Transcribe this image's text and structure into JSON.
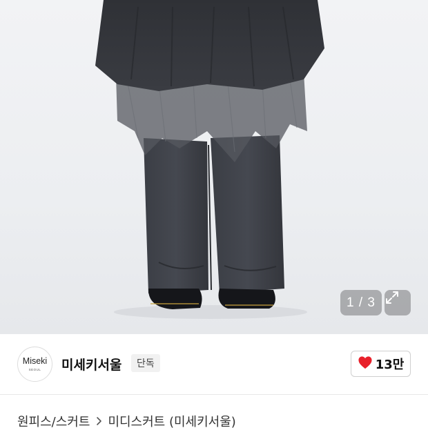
{
  "gallery": {
    "counter": "1 / 3",
    "current_index": 1,
    "total": 3,
    "expand_icon": "expand-arrows-icon"
  },
  "brand": {
    "logo_text": "Miseki",
    "logo_subtext": "SEOUL",
    "name": "미세키서울",
    "badge": "단독"
  },
  "like": {
    "icon": "heart-icon",
    "count": "13만",
    "color": "#e8202a"
  },
  "breadcrumb": {
    "category": "원피스/스커트",
    "subcategory": "미디스커트 (미세키서울)"
  }
}
